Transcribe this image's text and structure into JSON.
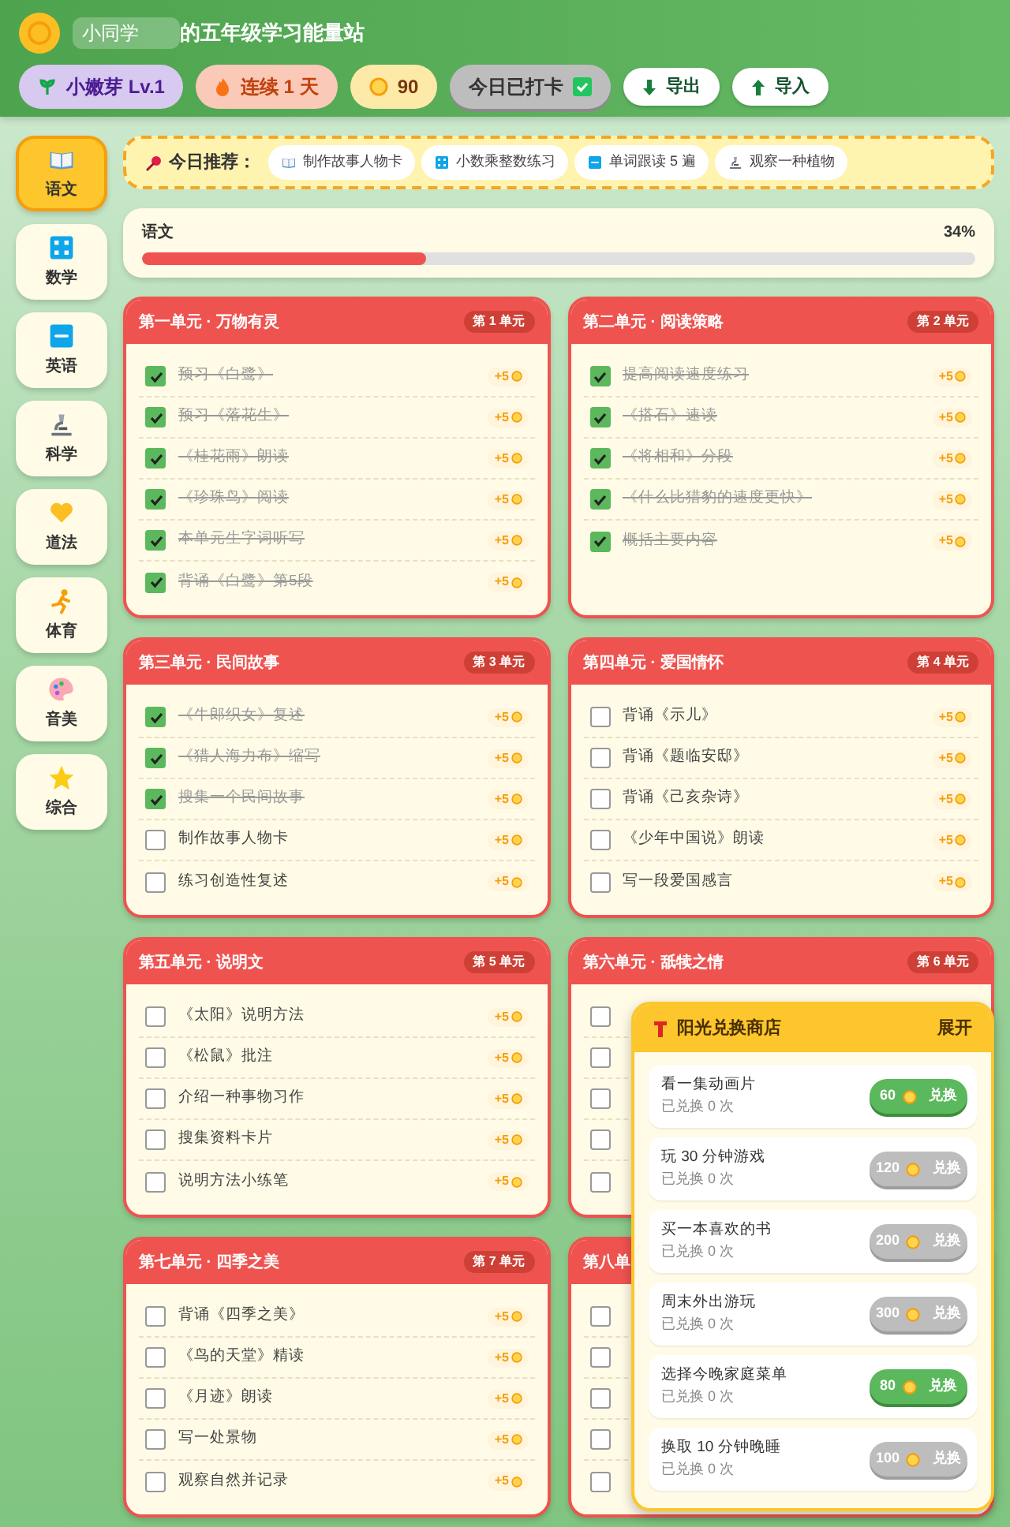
{
  "header": {
    "name_value": "小同学",
    "title_suffix": "的五年级学习能量站",
    "chips": [
      {
        "kind": "level",
        "label": "小嫩芽 Lv.1"
      },
      {
        "kind": "streak",
        "label": "连续 1 天"
      },
      {
        "kind": "points",
        "label": "90"
      },
      {
        "kind": "checkin",
        "label": "今日已打卡",
        "checked": true
      }
    ],
    "buttons": [
      {
        "kind": "export",
        "label": "导出"
      },
      {
        "kind": "import",
        "label": "导入"
      }
    ]
  },
  "subjects": [
    {
      "kind": "book",
      "label": "语文",
      "selected": true
    },
    {
      "kind": "numbers",
      "label": "数学",
      "selected": false
    },
    {
      "kind": "abc",
      "label": "英语",
      "selected": false
    },
    {
      "kind": "microscope",
      "label": "科学",
      "selected": false
    },
    {
      "kind": "heart",
      "label": "道法",
      "selected": false
    },
    {
      "kind": "runner",
      "label": "体育",
      "selected": false
    },
    {
      "kind": "palette",
      "label": "音美",
      "selected": false
    },
    {
      "kind": "star",
      "label": "综合",
      "selected": false
    }
  ],
  "recommendations": {
    "label": "今日推荐：",
    "items": [
      {
        "kind": "book",
        "label": "制作故事人物卡"
      },
      {
        "kind": "numbers",
        "label": "小数乘整数练习"
      },
      {
        "kind": "abc",
        "label": "单词跟读 5 遍"
      },
      {
        "kind": "microscope",
        "label": "观察一种植物"
      }
    ]
  },
  "progress": {
    "subject": "语文",
    "percent": "34%",
    "level": 0.34
  },
  "units": [
    {
      "title": "第一单元 · 万物有灵",
      "badge": "第 1 单元",
      "items": [
        {
          "label": "预习《白鹭》",
          "checked": true,
          "points": "+5"
        },
        {
          "label": "预习《落花生》",
          "checked": true,
          "points": "+5"
        },
        {
          "label": "《桂花雨》朗读",
          "checked": true,
          "points": "+5"
        },
        {
          "label": "《珍珠鸟》阅读",
          "checked": true,
          "points": "+5"
        },
        {
          "label": "本单元生字词听写",
          "checked": true,
          "points": "+5"
        },
        {
          "label": "背诵《白鹭》第5段",
          "checked": true,
          "points": "+5"
        }
      ]
    },
    {
      "title": "第二单元 · 阅读策略",
      "badge": "第 2 单元",
      "items": [
        {
          "label": "提高阅读速度练习",
          "checked": true,
          "points": "+5"
        },
        {
          "label": "《搭石》速读",
          "checked": true,
          "points": "+5"
        },
        {
          "label": "《将相和》分段",
          "checked": true,
          "points": "+5"
        },
        {
          "label": "《什么比猎豹的速度更快》",
          "checked": true,
          "points": "+5"
        },
        {
          "label": "概括主要内容",
          "checked": true,
          "points": "+5"
        }
      ]
    },
    {
      "title": "第三单元 · 民间故事",
      "badge": "第 3 单元",
      "items": [
        {
          "label": "《牛郎织女》复述",
          "checked": true,
          "points": "+5"
        },
        {
          "label": "《猎人海力布》缩写",
          "checked": true,
          "points": "+5"
        },
        {
          "label": "搜集一个民间故事",
          "checked": true,
          "points": "+5"
        },
        {
          "label": "制作故事人物卡",
          "checked": false,
          "points": "+5"
        },
        {
          "label": "练习创造性复述",
          "checked": false,
          "points": "+5"
        }
      ]
    },
    {
      "title": "第四单元 · 爱国情怀",
      "badge": "第 4 单元",
      "items": [
        {
          "label": "背诵《示儿》",
          "checked": false,
          "points": "+5"
        },
        {
          "label": "背诵《题临安邸》",
          "checked": false,
          "points": "+5"
        },
        {
          "label": "背诵《己亥杂诗》",
          "checked": false,
          "points": "+5"
        },
        {
          "label": "《少年中国说》朗读",
          "checked": false,
          "points": "+5"
        },
        {
          "label": "写一段爱国感言",
          "checked": false,
          "points": "+5"
        }
      ]
    },
    {
      "title": "第五单元 · 说明文",
      "badge": "第 5 单元",
      "items": [
        {
          "label": "《太阳》说明方法",
          "checked": false,
          "points": "+5"
        },
        {
          "label": "《松鼠》批注",
          "checked": false,
          "points": "+5"
        },
        {
          "label": "介绍一种事物习作",
          "checked": false,
          "points": "+5"
        },
        {
          "label": "搜集资料卡片",
          "checked": false,
          "points": "+5"
        },
        {
          "label": "说明方法小练笔",
          "checked": false,
          "points": "+5"
        }
      ]
    },
    {
      "title": "第六单元 · 舐犊之情",
      "badge": "第 6 单元",
      "items": [
        {
          "checked": false
        },
        {
          "checked": false
        },
        {
          "checked": false
        },
        {
          "checked": false
        },
        {
          "checked": false
        }
      ]
    },
    {
      "title": "第七单元 · 四季之美",
      "badge": "第 7 单元",
      "items": [
        {
          "label": "背诵《四季之美》",
          "checked": false,
          "points": "+5"
        },
        {
          "label": "《鸟的天堂》精读",
          "checked": false,
          "points": "+5"
        },
        {
          "label": "《月迹》朗读",
          "checked": false,
          "points": "+5"
        },
        {
          "label": "写一处景物",
          "checked": false,
          "points": "+5"
        },
        {
          "label": "观察自然并记录",
          "checked": false,
          "points": "+5"
        }
      ]
    },
    {
      "title": "第八单",
      "items": [
        {
          "checked": false
        },
        {
          "checked": false
        },
        {
          "checked": false
        },
        {
          "checked": false
        },
        {
          "checked": false
        }
      ]
    }
  ],
  "shop": {
    "title": "阳光兑换商店",
    "toggle": "展开",
    "items": [
      {
        "name": "看一集动画片",
        "count": "已兑换 0 次",
        "cost": "60",
        "action": "兑换",
        "disabled": false
      },
      {
        "name": "玩 30 分钟游戏",
        "count": "已兑换 0 次",
        "cost": "120",
        "action": "兑换",
        "disabled": true
      },
      {
        "name": "买一本喜欢的书",
        "count": "已兑换 0 次",
        "cost": "200",
        "action": "兑换",
        "disabled": true
      },
      {
        "name": "周末外出游玩",
        "count": "已兑换 0 次",
        "cost": "300",
        "action": "兑换",
        "disabled": true
      },
      {
        "name": "选择今晚家庭菜单",
        "count": "已兑换 0 次",
        "cost": "80",
        "action": "兑换",
        "disabled": false
      },
      {
        "name": "换取 10 分钟晚睡",
        "count": "已兑换 0 次",
        "cost": "100",
        "action": "兑换",
        "disabled": true
      }
    ]
  }
}
